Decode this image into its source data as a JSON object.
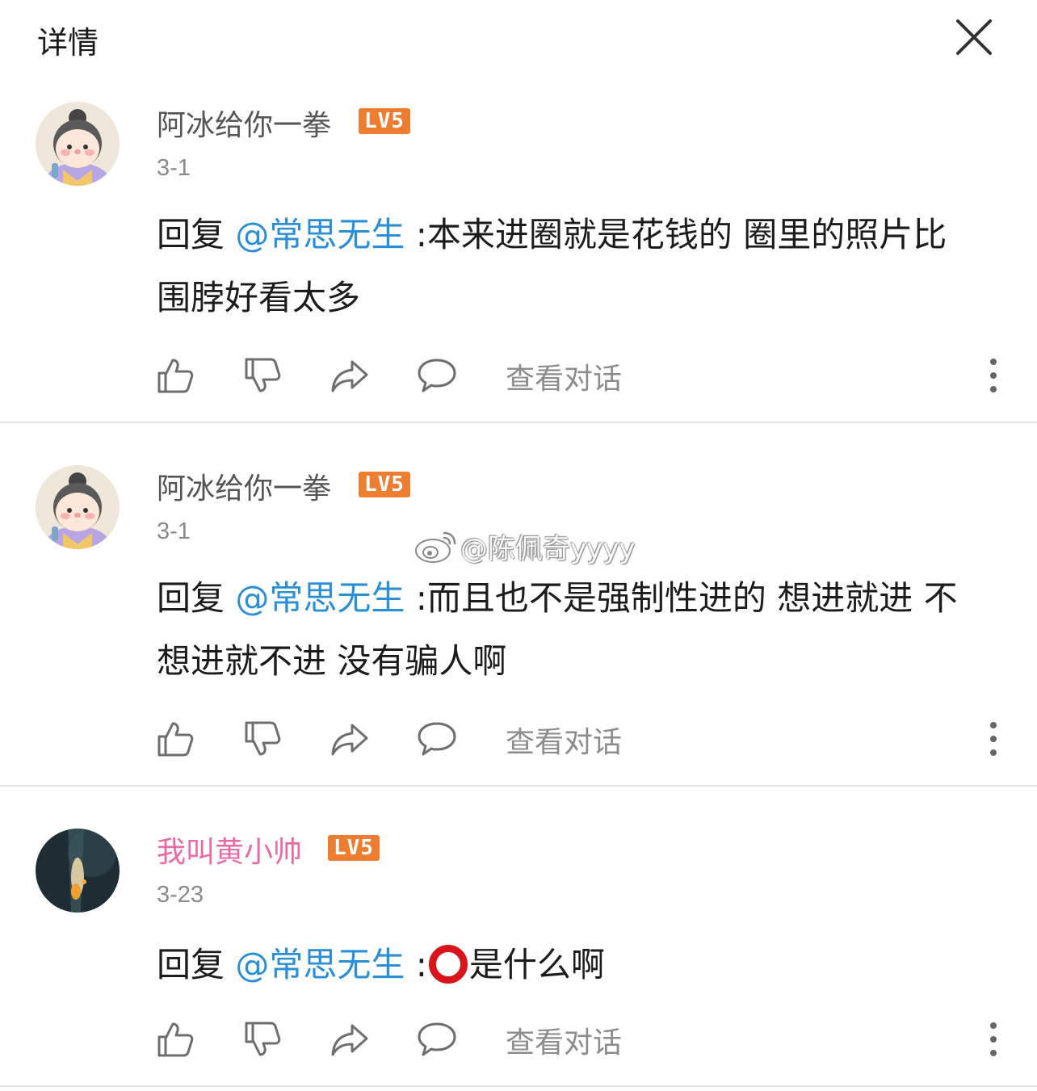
{
  "header": {
    "title": "详情"
  },
  "comments": [
    {
      "username": "阿冰给你一拳",
      "level": "LV5",
      "date": "3-1",
      "reply_prefix": "回复 ",
      "mention": "@常思无生",
      "text_line1": " :本来进圈就是花钱的 圈里的照片比",
      "text_line2": "围脖好看太多"
    },
    {
      "username": "阿冰给你一拳",
      "level": "LV5",
      "date": "3-1",
      "reply_prefix": "回复 ",
      "mention": "@常思无生",
      "text_line1": " :而且也不是强制性进的 想进就进 不",
      "text_line2": "想进就不进 没有骗人啊"
    },
    {
      "username": "我叫黄小帅",
      "level": "LV5",
      "date": "3-23",
      "reply_prefix": "回复 ",
      "mention": "@常思无生",
      "text_before": " :",
      "text_after": "是什么啊"
    }
  ],
  "actions": {
    "view_conversation": "查看对话"
  },
  "watermark": "@陈佩奇yyyy",
  "colors": {
    "mention": "#2a8fd6",
    "level_badge": "#ed7d31",
    "pink_username": "#e86aa6",
    "ring": "#d8151b"
  }
}
